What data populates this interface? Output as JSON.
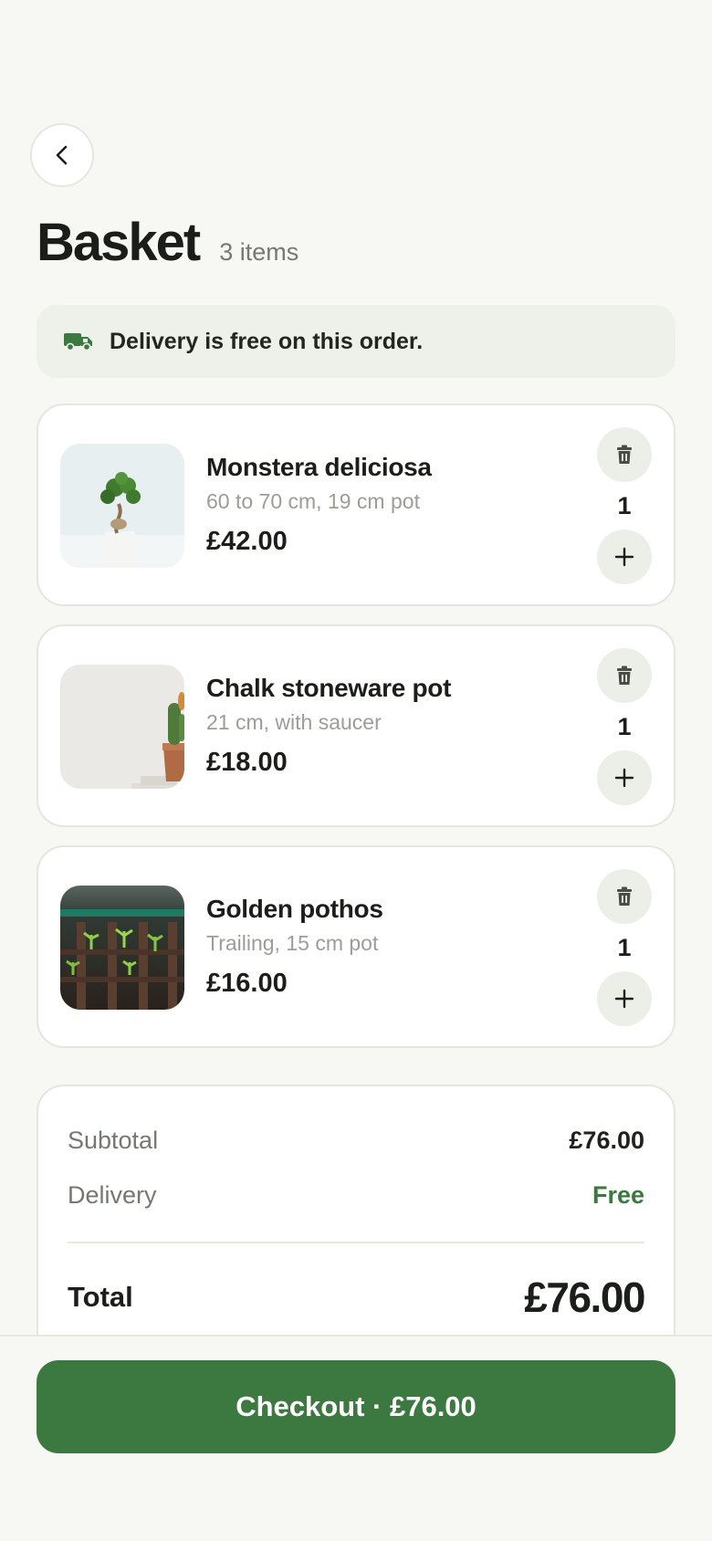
{
  "header": {
    "back_icon": "chevron-left-icon",
    "title": "Basket",
    "item_count": "3 items"
  },
  "delivery_banner": {
    "icon": "truck-icon",
    "text": "Delivery is free on this order."
  },
  "items": [
    {
      "name": "Monstera deliciosa",
      "variant": "60 to 70 cm, 19 cm pot",
      "price": "£42.00",
      "quantity": "1"
    },
    {
      "name": "Chalk stoneware pot",
      "variant": "21 cm, with saucer",
      "price": "£18.00",
      "quantity": "1"
    },
    {
      "name": "Golden pothos",
      "variant": "Trailing, 15 cm pot",
      "price": "£16.00",
      "quantity": "1"
    }
  ],
  "summary": {
    "subtotal_label": "Subtotal",
    "subtotal_value": "£76.00",
    "delivery_label": "Delivery",
    "delivery_value": "Free",
    "total_label": "Total",
    "total_value": "£76.00"
  },
  "checkout": {
    "label": "Checkout · £76.00"
  },
  "colors": {
    "accent": "#3c7940",
    "background": "#f7f7f3",
    "free_text": "#3b7a3e"
  }
}
